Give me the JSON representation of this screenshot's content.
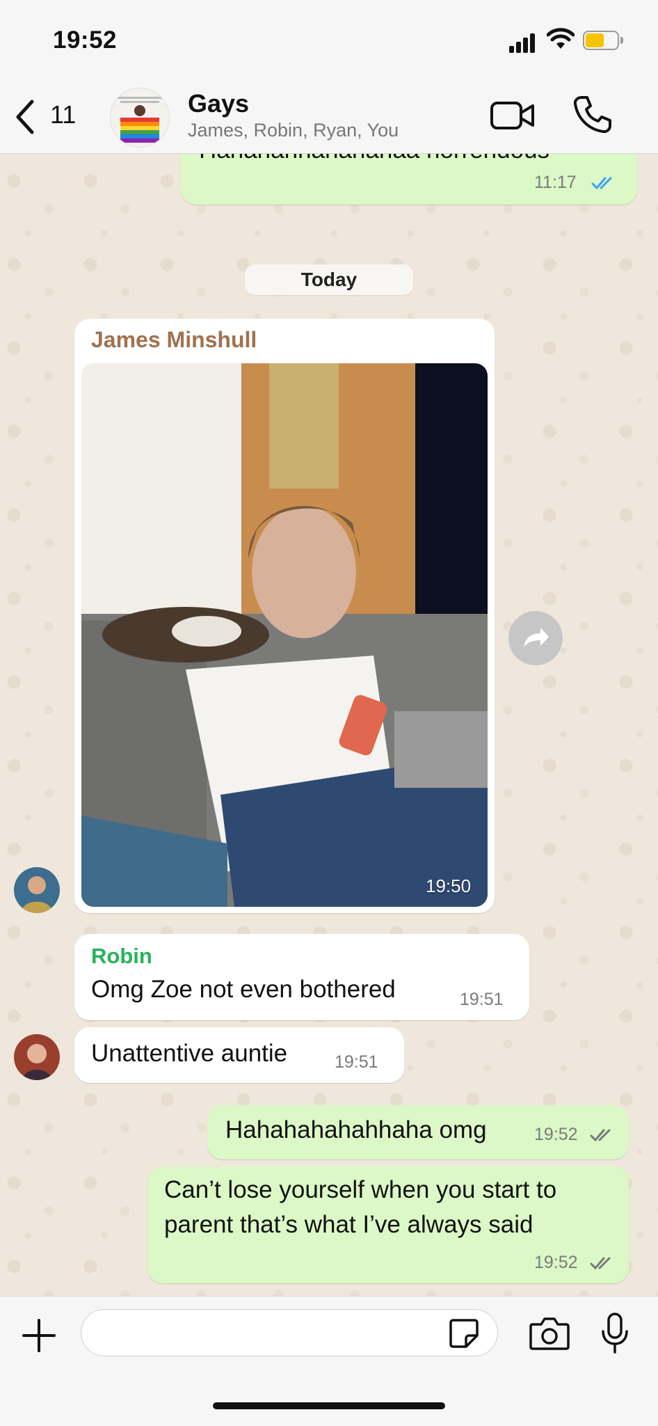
{
  "status_bar": {
    "time": "19:52"
  },
  "header": {
    "back_count": "11",
    "group_name": "Gays",
    "members": "James, Robin, Ryan, You",
    "icons": [
      "video-call-icon",
      "phone-call-icon",
      "back-chevron-icon"
    ]
  },
  "messages": {
    "top_partial": {
      "text": "Hahahahhahahahaa horrendous",
      "time": "11:17",
      "status": "read"
    },
    "date_separator": "Today",
    "photo_message": {
      "sender": "James Minshull",
      "sender_color": "#a0724e",
      "time": "19:50"
    },
    "robin_1": {
      "sender": "Robin",
      "sender_color": "#27b35a",
      "text": "Omg Zoe not even bothered",
      "time": "19:51"
    },
    "robin_2": {
      "text": "Unattentive auntie",
      "time": "19:51"
    },
    "out_1": {
      "text": "Hahahahahahhaha omg",
      "time": "19:52",
      "status": "delivered"
    },
    "out_2": {
      "text_line1": "Can’t lose yourself when you start to",
      "text_line2": "parent that’s what I’ve always said",
      "time": "19:52",
      "status": "delivered"
    }
  },
  "composer": {
    "placeholder": ""
  },
  "colors": {
    "outgoing_bubble": "#dbf8c6",
    "incoming_bubble": "#ffffff",
    "read_tick": "#3ba1f2",
    "battery": "#f5c400"
  }
}
